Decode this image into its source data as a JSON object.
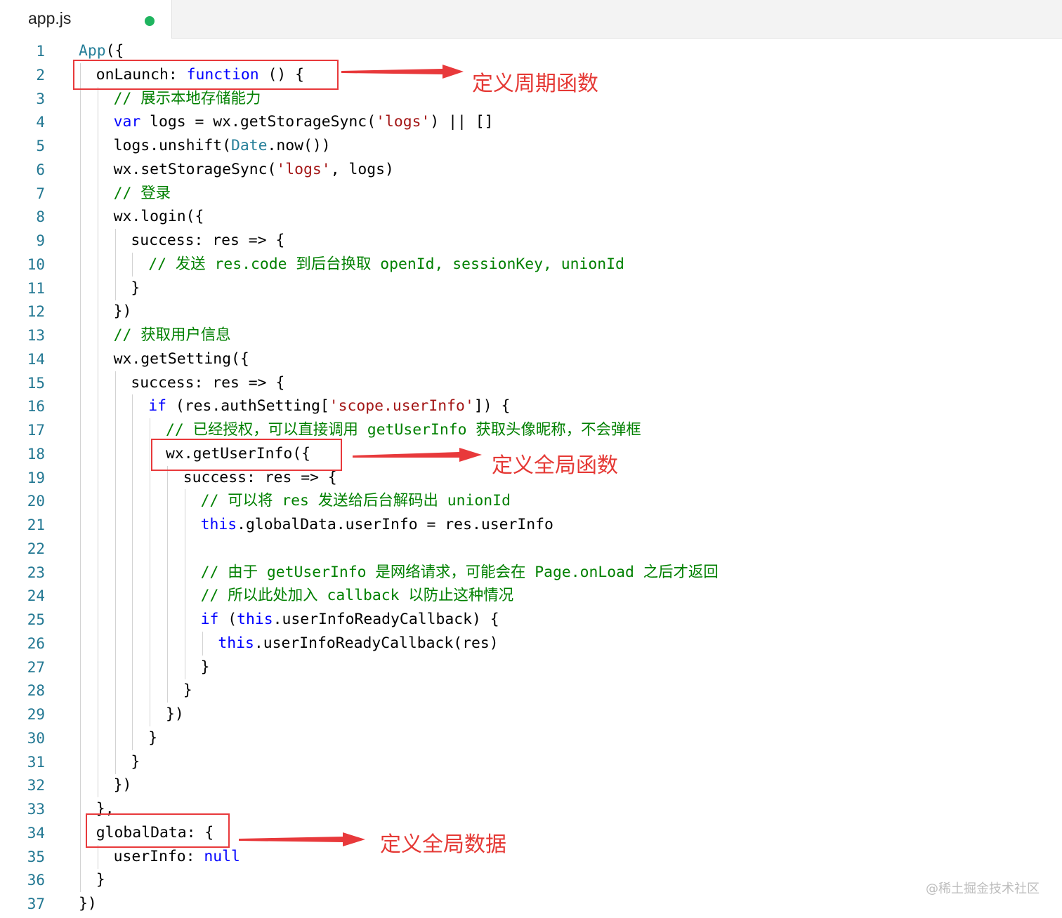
{
  "tab": {
    "filename": "app.js"
  },
  "lines": [
    {
      "n": "1",
      "indent": 0,
      "tokens": [
        {
          "t": "App",
          "c": "type"
        },
        {
          "t": "({",
          "c": "plain"
        }
      ]
    },
    {
      "n": "2",
      "indent": 1,
      "tokens": [
        {
          "t": "onLaunch: ",
          "c": "plain"
        },
        {
          "t": "function",
          "c": "kw"
        },
        {
          "t": " () {",
          "c": "plain"
        }
      ]
    },
    {
      "n": "3",
      "indent": 2,
      "tokens": [
        {
          "t": "// 展示本地存储能力",
          "c": "cmt"
        }
      ]
    },
    {
      "n": "4",
      "indent": 2,
      "tokens": [
        {
          "t": "var",
          "c": "kw"
        },
        {
          "t": " logs = wx.getStorageSync(",
          "c": "plain"
        },
        {
          "t": "'logs'",
          "c": "str"
        },
        {
          "t": ") || []",
          "c": "plain"
        }
      ]
    },
    {
      "n": "5",
      "indent": 2,
      "tokens": [
        {
          "t": "logs.unshift(",
          "c": "plain"
        },
        {
          "t": "Date",
          "c": "type"
        },
        {
          "t": ".now())",
          "c": "plain"
        }
      ]
    },
    {
      "n": "6",
      "indent": 2,
      "tokens": [
        {
          "t": "wx.setStorageSync(",
          "c": "plain"
        },
        {
          "t": "'logs'",
          "c": "str"
        },
        {
          "t": ", logs)",
          "c": "plain"
        }
      ]
    },
    {
      "n": "7",
      "indent": 2,
      "tokens": [
        {
          "t": "// 登录",
          "c": "cmt"
        }
      ]
    },
    {
      "n": "8",
      "indent": 2,
      "tokens": [
        {
          "t": "wx.login({",
          "c": "plain"
        }
      ]
    },
    {
      "n": "9",
      "indent": 3,
      "tokens": [
        {
          "t": "success: res => {",
          "c": "plain"
        }
      ]
    },
    {
      "n": "10",
      "indent": 4,
      "tokens": [
        {
          "t": "// 发送 res.code 到后台换取 openId, sessionKey, unionId",
          "c": "cmt"
        }
      ]
    },
    {
      "n": "11",
      "indent": 3,
      "tokens": [
        {
          "t": "}",
          "c": "plain"
        }
      ]
    },
    {
      "n": "12",
      "indent": 2,
      "tokens": [
        {
          "t": "})",
          "c": "plain"
        }
      ]
    },
    {
      "n": "13",
      "indent": 2,
      "tokens": [
        {
          "t": "// 获取用户信息",
          "c": "cmt"
        }
      ]
    },
    {
      "n": "14",
      "indent": 2,
      "tokens": [
        {
          "t": "wx.getSetting({",
          "c": "plain"
        }
      ]
    },
    {
      "n": "15",
      "indent": 3,
      "tokens": [
        {
          "t": "success: res => {",
          "c": "plain"
        }
      ]
    },
    {
      "n": "16",
      "indent": 4,
      "tokens": [
        {
          "t": "if",
          "c": "kw"
        },
        {
          "t": " (res.authSetting[",
          "c": "plain"
        },
        {
          "t": "'scope.userInfo'",
          "c": "str"
        },
        {
          "t": "]) {",
          "c": "plain"
        }
      ]
    },
    {
      "n": "17",
      "indent": 5,
      "tokens": [
        {
          "t": "// 已经授权，可以直接调用 getUserInfo 获取头像昵称，不会弹框",
          "c": "cmt"
        }
      ]
    },
    {
      "n": "18",
      "indent": 5,
      "tokens": [
        {
          "t": "wx.getUserInfo({",
          "c": "plain"
        }
      ]
    },
    {
      "n": "19",
      "indent": 6,
      "tokens": [
        {
          "t": "success: res => {",
          "c": "plain"
        }
      ]
    },
    {
      "n": "20",
      "indent": 7,
      "tokens": [
        {
          "t": "// 可以将 res 发送给后台解码出 unionId",
          "c": "cmt"
        }
      ]
    },
    {
      "n": "21",
      "indent": 7,
      "tokens": [
        {
          "t": "this",
          "c": "kw"
        },
        {
          "t": ".globalData.userInfo = res.userInfo",
          "c": "plain"
        }
      ]
    },
    {
      "n": "22",
      "indent": 7,
      "tokens": []
    },
    {
      "n": "23",
      "indent": 7,
      "tokens": [
        {
          "t": "// 由于 getUserInfo 是网络请求，可能会在 Page.onLoad 之后才返回",
          "c": "cmt"
        }
      ]
    },
    {
      "n": "24",
      "indent": 7,
      "tokens": [
        {
          "t": "// 所以此处加入 callback 以防止这种情况",
          "c": "cmt"
        }
      ]
    },
    {
      "n": "25",
      "indent": 7,
      "tokens": [
        {
          "t": "if",
          "c": "kw"
        },
        {
          "t": " (",
          "c": "plain"
        },
        {
          "t": "this",
          "c": "kw"
        },
        {
          "t": ".userInfoReadyCallback) {",
          "c": "plain"
        }
      ]
    },
    {
      "n": "26",
      "indent": 8,
      "tokens": [
        {
          "t": "this",
          "c": "kw"
        },
        {
          "t": ".userInfoReadyCallback(res)",
          "c": "plain"
        }
      ]
    },
    {
      "n": "27",
      "indent": 7,
      "tokens": [
        {
          "t": "}",
          "c": "plain"
        }
      ]
    },
    {
      "n": "28",
      "indent": 6,
      "tokens": [
        {
          "t": "}",
          "c": "plain"
        }
      ]
    },
    {
      "n": "29",
      "indent": 5,
      "tokens": [
        {
          "t": "})",
          "c": "plain"
        }
      ]
    },
    {
      "n": "30",
      "indent": 4,
      "tokens": [
        {
          "t": "}",
          "c": "plain"
        }
      ]
    },
    {
      "n": "31",
      "indent": 3,
      "tokens": [
        {
          "t": "}",
          "c": "plain"
        }
      ]
    },
    {
      "n": "32",
      "indent": 2,
      "tokens": [
        {
          "t": "})",
          "c": "plain"
        }
      ]
    },
    {
      "n": "33",
      "indent": 1,
      "tokens": [
        {
          "t": "},",
          "c": "plain"
        }
      ]
    },
    {
      "n": "34",
      "indent": 1,
      "tokens": [
        {
          "t": "globalData: {",
          "c": "plain"
        }
      ]
    },
    {
      "n": "35",
      "indent": 2,
      "tokens": [
        {
          "t": "userInfo: ",
          "c": "plain"
        },
        {
          "t": "null",
          "c": "kw"
        }
      ]
    },
    {
      "n": "36",
      "indent": 1,
      "tokens": [
        {
          "t": "}",
          "c": "plain"
        }
      ]
    },
    {
      "n": "37",
      "indent": 0,
      "tokens": [
        {
          "t": "})",
          "c": "plain"
        }
      ]
    }
  ],
  "annotations": [
    {
      "label": "定义周期函数"
    },
    {
      "label": "定义全局函数"
    },
    {
      "label": "定义全局数据"
    }
  ],
  "watermark": "@稀土掘金技术社区",
  "colors": {
    "keyword": "#0000ff",
    "string": "#a31515",
    "comment": "#008000",
    "type": "#267f99",
    "line_number": "#237893",
    "annotation": "#e53935",
    "modified_dot": "#1fb45f"
  }
}
